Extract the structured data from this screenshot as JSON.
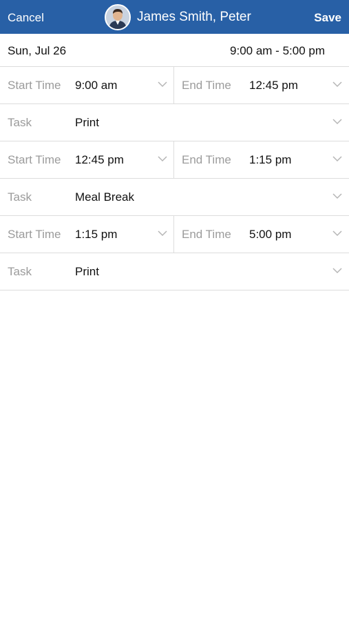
{
  "header": {
    "cancel_label": "Cancel",
    "title": "James Smith, Peter",
    "save_label": "Save",
    "bar_color": "#2860a6"
  },
  "summary": {
    "date": "Sun, Jul 26",
    "time_range": "9:00 am - 5:00 pm"
  },
  "segments": [
    {
      "start_label": "Start Time",
      "start_value": "9:00 am",
      "end_label": "End Time",
      "end_value": "12:45 pm",
      "task_label": "Task",
      "task_value": "Print"
    },
    {
      "start_label": "Start Time",
      "start_value": "12:45 pm",
      "end_label": "End Time",
      "end_value": "1:15 pm",
      "task_label": "Task",
      "task_value": "Meal Break"
    },
    {
      "start_label": "Start Time",
      "start_value": "1:15 pm",
      "end_label": "End Time",
      "end_value": "5:00 pm",
      "task_label": "Task",
      "task_value": "Print"
    }
  ]
}
